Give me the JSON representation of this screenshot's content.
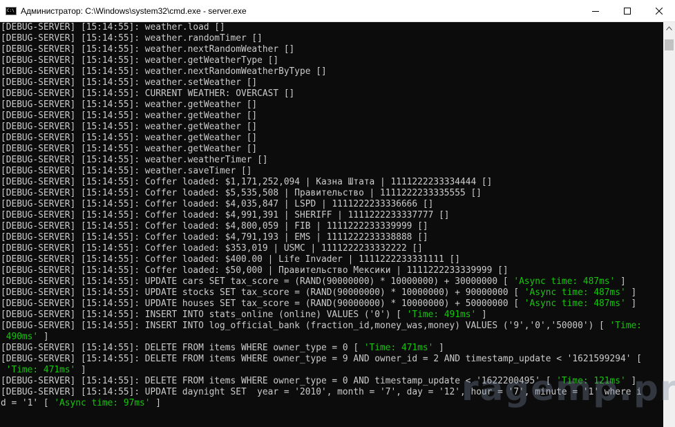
{
  "window": {
    "title": "Администратор: C:\\Windows\\system32\\cmd.exe - server.exe",
    "icon": "cmd-icon",
    "controls": [
      "minimize-icon",
      "maximize-icon",
      "close-icon"
    ]
  },
  "colors": {
    "background": "#0c0c0c",
    "text": "#cccccc",
    "highlight": "#16c60c"
  },
  "console": {
    "lines": [
      [
        {
          "t": "[DEBUG-SERVER] [15:14:55]: weather.load []"
        }
      ],
      [
        {
          "t": "[DEBUG-SERVER] [15:14:55]: weather.randomTimer []"
        }
      ],
      [
        {
          "t": "[DEBUG-SERVER] [15:14:55]: weather.nextRandomWeather []"
        }
      ],
      [
        {
          "t": "[DEBUG-SERVER] [15:14:55]: weather.getWeatherType []"
        }
      ],
      [
        {
          "t": "[DEBUG-SERVER] [15:14:55]: weather.nextRandomWeatherByType []"
        }
      ],
      [
        {
          "t": "[DEBUG-SERVER] [15:14:55]: weather.setWeather []"
        }
      ],
      [
        {
          "t": "[DEBUG-SERVER] [15:14:55]: CURRENT WEATHER: OVERCAST []"
        }
      ],
      [
        {
          "t": "[DEBUG-SERVER] [15:14:55]: weather.getWeather []"
        }
      ],
      [
        {
          "t": "[DEBUG-SERVER] [15:14:55]: weather.getWeather []"
        }
      ],
      [
        {
          "t": "[DEBUG-SERVER] [15:14:55]: weather.getWeather []"
        }
      ],
      [
        {
          "t": "[DEBUG-SERVER] [15:14:55]: weather.getWeather []"
        }
      ],
      [
        {
          "t": "[DEBUG-SERVER] [15:14:55]: weather.getWeather []"
        }
      ],
      [
        {
          "t": "[DEBUG-SERVER] [15:14:55]: weather.weatherTimer []"
        }
      ],
      [
        {
          "t": "[DEBUG-SERVER] [15:14:55]: weather.saveTimer []"
        }
      ],
      [
        {
          "t": "[DEBUG-SERVER] [15:14:55]: Coffer loaded: $1,171,252,094 | Казна Штата | 1111222233334444 []"
        }
      ],
      [
        {
          "t": "[DEBUG-SERVER] [15:14:55]: Coffer loaded: $5,535,508 | Правительство | 1111222233335555 []"
        }
      ],
      [
        {
          "t": "[DEBUG-SERVER] [15:14:55]: Coffer loaded: $4,035,847 | LSPD | 1111222233336666 []"
        }
      ],
      [
        {
          "t": "[DEBUG-SERVER] [15:14:55]: Coffer loaded: $4,991,391 | SHERIFF | 1111222233337777 []"
        }
      ],
      [
        {
          "t": "[DEBUG-SERVER] [15:14:55]: Coffer loaded: $4,800,059 | FIB | 1111222233339999 []"
        }
      ],
      [
        {
          "t": "[DEBUG-SERVER] [15:14:55]: Coffer loaded: $4,791,193 | EMS | 1111222233338888 []"
        }
      ],
      [
        {
          "t": "[DEBUG-SERVER] [15:14:55]: Coffer loaded: $353,019 | USMC | 1111222233332222 []"
        }
      ],
      [
        {
          "t": "[DEBUG-SERVER] [15:14:55]: Coffer loaded: $400.00 | Life Invader | 1111222233331111 []"
        }
      ],
      [
        {
          "t": "[DEBUG-SERVER] [15:14:55]: Coffer loaded: $50,000 | Правительство Мексики | 1111222233339999 []"
        }
      ],
      [
        {
          "t": "[DEBUG-SERVER] [15:14:55]: UPDATE cars SET tax_score = (RAND(90000000) * 10000000) + 30000000 [ "
        },
        {
          "t": "'Async time: 487ms'",
          "g": true
        },
        {
          "t": " ]"
        }
      ],
      [
        {
          "t": "[DEBUG-SERVER] [15:14:55]: UPDATE stocks SET tax_score = (RAND(90000000) * 10000000) + 90000000 [ "
        },
        {
          "t": "'Async time: 487ms'",
          "g": true
        },
        {
          "t": " ]"
        }
      ],
      [
        {
          "t": "[DEBUG-SERVER] [15:14:55]: UPDATE houses SET tax_score = (RAND(90000000) * 10000000) + 50000000 [ "
        },
        {
          "t": "'Async time: 487ms'",
          "g": true
        },
        {
          "t": " ]"
        }
      ],
      [
        {
          "t": "[DEBUG-SERVER] [15:14:55]: INSERT INTO stats_online (online) VALUES ('0') [ "
        },
        {
          "t": "'Time: 491ms'",
          "g": true
        },
        {
          "t": " ]"
        }
      ],
      [
        {
          "t": "[DEBUG-SERVER] [15:14:55]: INSERT INTO log_official_bank (fraction_id,money_was,money) VALUES ('9','0','50000') [ "
        },
        {
          "t": "'Time:",
          "g": true
        }
      ],
      [
        {
          "t": " 490ms'",
          "g": true
        },
        {
          "t": " ]"
        }
      ],
      [
        {
          "t": "[DEBUG-SERVER] [15:14:55]: DELETE FROM items WHERE owner_type = 0 [ "
        },
        {
          "t": "'Time: 471ms'",
          "g": true
        },
        {
          "t": " ]"
        }
      ],
      [
        {
          "t": "[DEBUG-SERVER] [15:14:55]: DELETE FROM items WHERE owner_type = 9 AND owner_id = 2 AND timestamp_update < '1621599294' ["
        }
      ],
      [
        {
          "t": " "
        },
        {
          "t": "'Time: 471ms'",
          "g": true
        },
        {
          "t": " ]"
        }
      ],
      [
        {
          "t": "[DEBUG-SERVER] [15:14:55]: DELETE FROM items WHERE owner_type = 0 AND timestamp_update < '1622200495' [ "
        },
        {
          "t": "'Time: 121ms'",
          "g": true
        },
        {
          "t": " ]"
        }
      ],
      [
        {
          "t": "[DEBUG-SERVER] [15:14:55]: UPDATE daynight SET  year = '2010', month = '7', day = '12', hour = '7', minute = '1' where i"
        }
      ],
      [
        {
          "t": "d = '1' [ "
        },
        {
          "t": "'Async time: 97ms'",
          "g": true
        },
        {
          "t": " ]"
        }
      ]
    ]
  },
  "watermark": "ragemp.pro"
}
